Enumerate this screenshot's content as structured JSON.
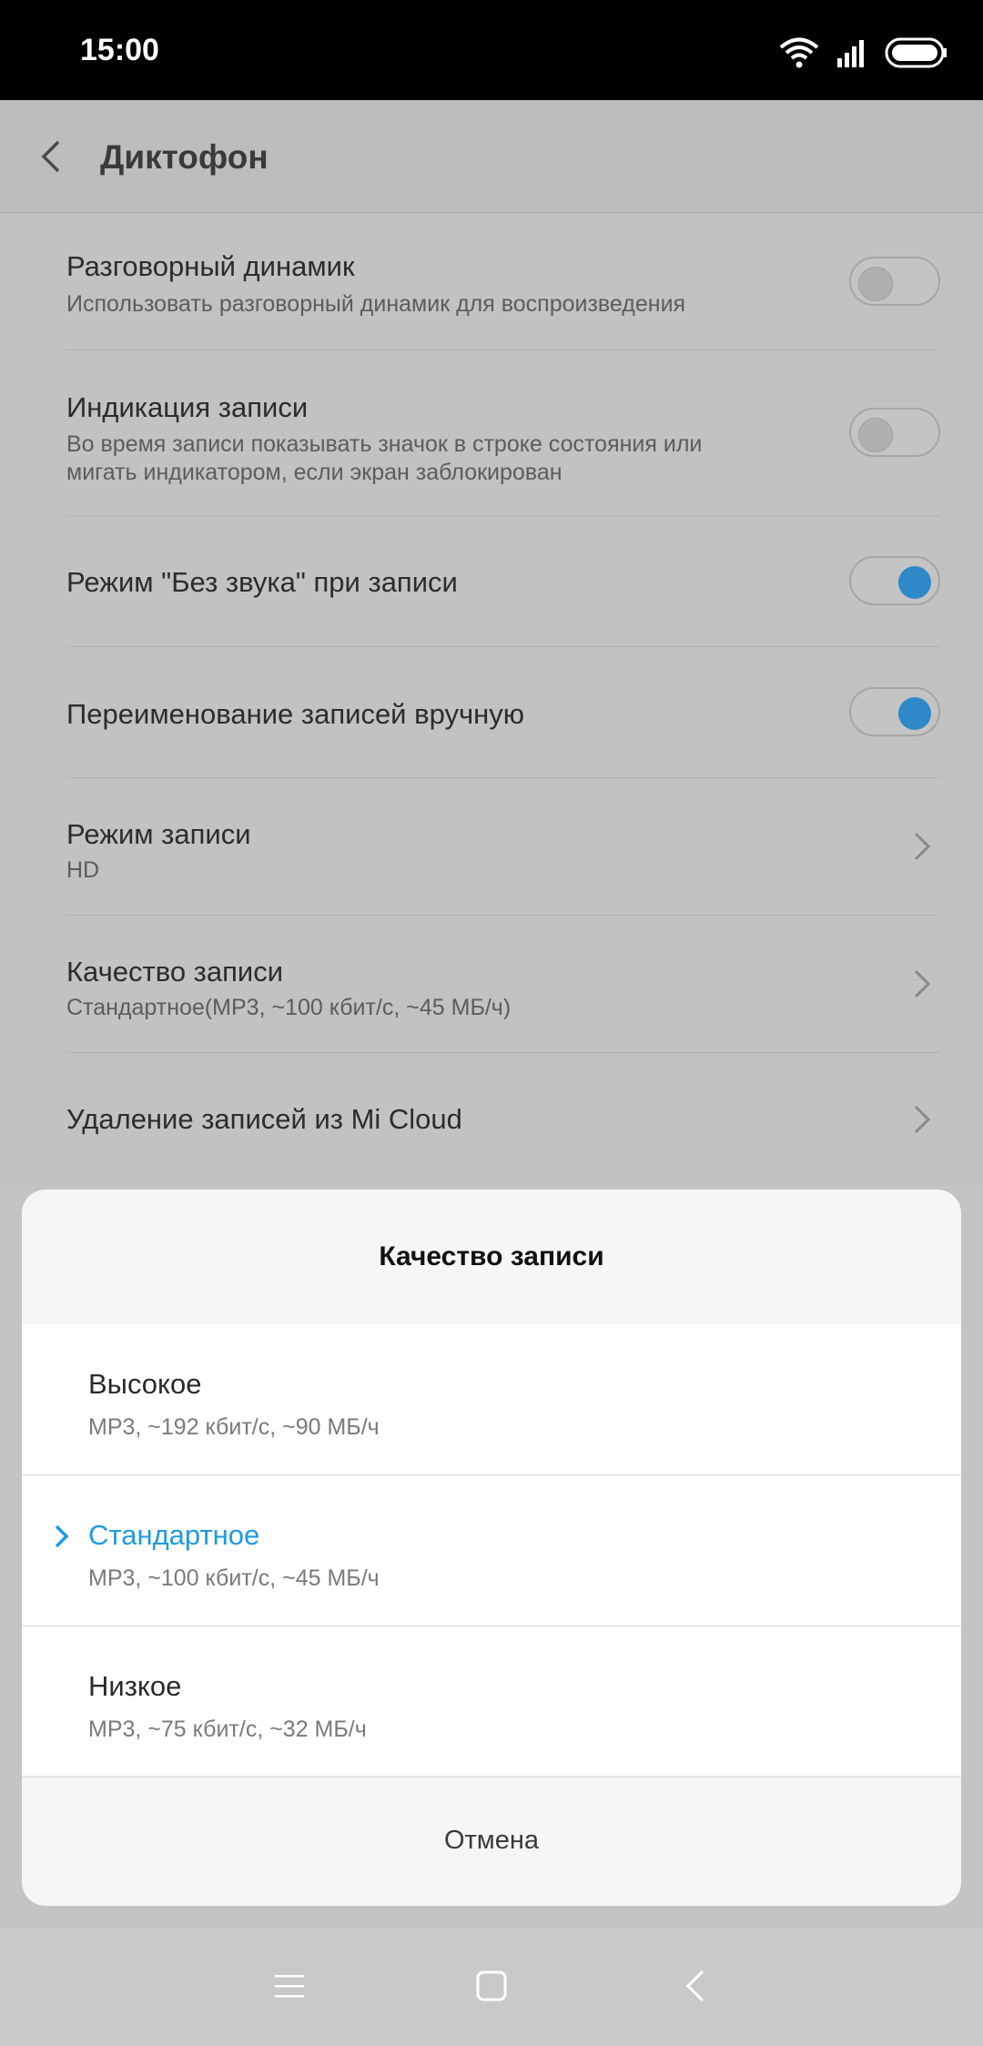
{
  "status": {
    "time": "15:00",
    "icons": [
      "wifi-icon",
      "signal-icon",
      "battery-icon"
    ]
  },
  "header": {
    "title": "Диктофон",
    "back_icon": "chevron-left-icon"
  },
  "settings": [
    {
      "title": "Разговорный динамик",
      "subtitle": "Использовать разговорный динамик для воспроизведения",
      "control": "toggle",
      "on": false
    },
    {
      "title": "Индикация записи",
      "subtitle": "Во время записи показывать значок в строке состояния или мигать индикатором, если экран заблокирован",
      "control": "toggle",
      "on": false
    },
    {
      "title": "Режим \"Без звука\" при записи",
      "subtitle": "",
      "control": "toggle",
      "on": true
    },
    {
      "title": "Переименование записей вручную",
      "subtitle": "",
      "control": "toggle",
      "on": true
    },
    {
      "title": "Режим записи",
      "subtitle": "HD",
      "control": "chevron"
    },
    {
      "title": "Качество записи",
      "subtitle": "Стандартное(MP3, ~100 кбит/с, ~45 МБ/ч)",
      "control": "chevron"
    },
    {
      "title": "Удаление записей из Mi Cloud",
      "subtitle": "",
      "control": "chevron"
    }
  ],
  "dialog": {
    "title": "Качество записи",
    "options": [
      {
        "label": "Высокое",
        "detail": "MP3, ~192 кбит/с, ~90 МБ/ч",
        "selected": false
      },
      {
        "label": "Стандартное",
        "detail": "MP3, ~100 кбит/с, ~45 МБ/ч",
        "selected": true
      },
      {
        "label": "Низкое",
        "detail": "MP3, ~75 кбит/с, ~32 МБ/ч",
        "selected": false
      }
    ],
    "cancel_label": "Отмена"
  },
  "navbar": {
    "buttons": [
      "menu-icon",
      "home-icon",
      "back-icon"
    ]
  },
  "colors": {
    "accent": "#1e9ae4",
    "toggle_on": "#2f89c8"
  }
}
